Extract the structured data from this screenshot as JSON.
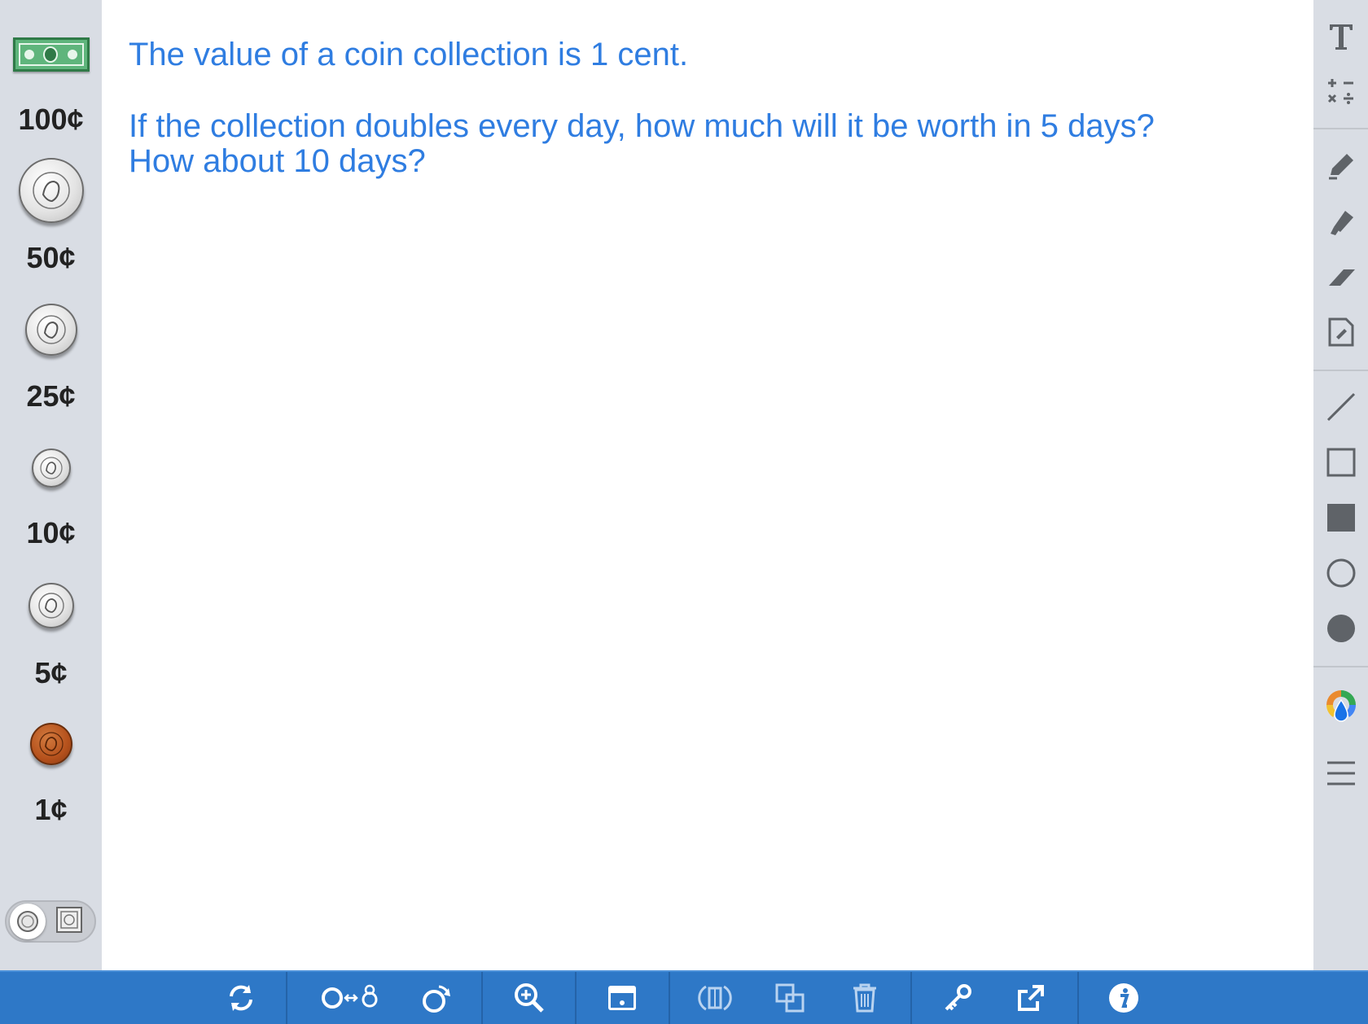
{
  "money_sidebar": {
    "items": [
      {
        "name": "dollar-bill",
        "label": "100¢"
      },
      {
        "name": "half-dollar",
        "label": "50¢"
      },
      {
        "name": "quarter",
        "label": "25¢"
      },
      {
        "name": "dime",
        "label": "10¢"
      },
      {
        "name": "nickel",
        "label": "5¢"
      },
      {
        "name": "penny",
        "label": "1¢"
      }
    ]
  },
  "canvas": {
    "line1": "The value of a coin collection is 1 cent.",
    "line2": "If the collection doubles every day, how much will it be worth in 5 days?",
    "line3": "How about 10 days?"
  },
  "tools": {
    "text": "text-tool",
    "math": "math-tool",
    "pen": "pen-tool",
    "marker": "marker-tool",
    "eraser": "eraser-tool",
    "note": "note-tool",
    "line": "line-tool",
    "rect_outline": "rectangle-outline-tool",
    "rect_filled": "rectangle-filled-tool",
    "circle_outline": "circle-outline-tool",
    "circle_filled": "circle-filled-tool",
    "color": "color-picker",
    "menu": "menu"
  },
  "colors": {
    "accent_text": "#2f7de1",
    "toolbar": "#2e78c7",
    "sidebar": "#d9dde4",
    "tool_icon": "#5f6368"
  }
}
